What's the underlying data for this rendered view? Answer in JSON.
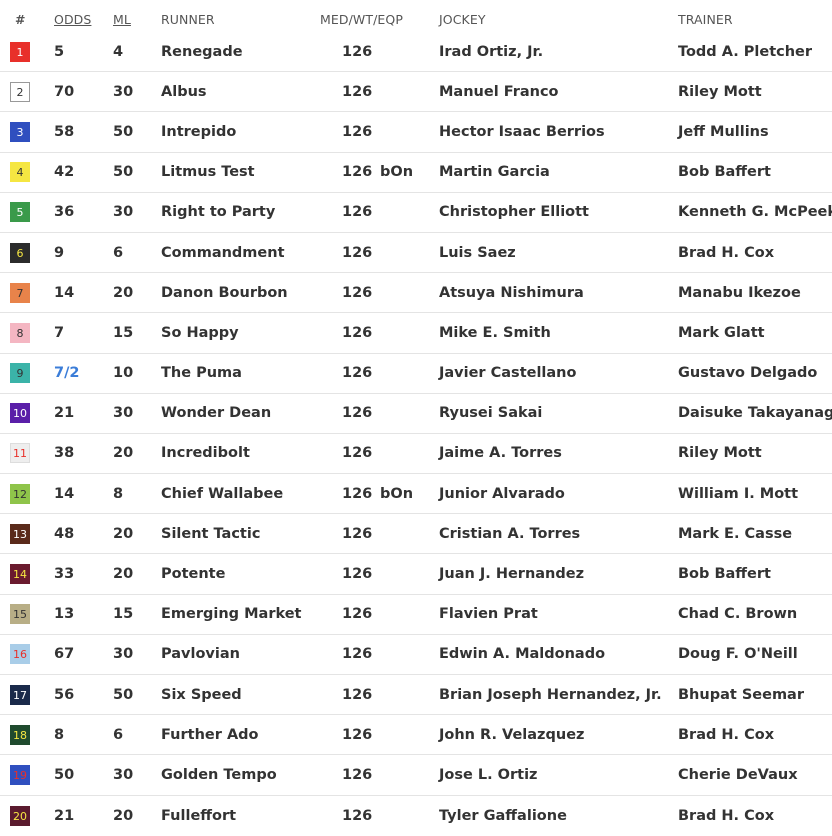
{
  "header": {
    "num": "#",
    "odds": "ODDS",
    "ml": "ML",
    "runner": "RUNNER",
    "med": "MED/WT/EQP",
    "jockey": "JOCKEY",
    "trainer": "TRAINER"
  },
  "rows": [
    {
      "pp": "1",
      "odds": "5",
      "ml": "4",
      "runner": "Renegade",
      "wt": "126",
      "eqp": "",
      "jockey": "Irad Ortiz, Jr.",
      "trainer": "Todd A. Pletcher",
      "cloth_bg": "#e8302a",
      "cloth_fg": "#ffffff",
      "cloth_border": "#e8302a"
    },
    {
      "pp": "2",
      "odds": "70",
      "ml": "30",
      "runner": "Albus",
      "wt": "126",
      "eqp": "",
      "jockey": "Manuel Franco",
      "trainer": "Riley Mott",
      "cloth_bg": "#ffffff",
      "cloth_fg": "#333333",
      "cloth_border": "#999999"
    },
    {
      "pp": "3",
      "odds": "58",
      "ml": "50",
      "runner": "Intrepido",
      "wt": "126",
      "eqp": "",
      "jockey": "Hector Isaac Berrios",
      "trainer": "Jeff Mullins",
      "cloth_bg": "#2f4fbf",
      "cloth_fg": "#ffffff",
      "cloth_border": "#2f4fbf"
    },
    {
      "pp": "4",
      "odds": "42",
      "ml": "50",
      "runner": "Litmus Test",
      "wt": "126",
      "eqp": "bOn",
      "jockey": "Martin Garcia",
      "trainer": "Bob Baffert",
      "cloth_bg": "#f5e642",
      "cloth_fg": "#333333",
      "cloth_border": "#f5e642"
    },
    {
      "pp": "5",
      "odds": "36",
      "ml": "30",
      "runner": "Right to Party",
      "wt": "126",
      "eqp": "",
      "jockey": "Christopher Elliott",
      "trainer": "Kenneth G. McPeek",
      "cloth_bg": "#3a9a4a",
      "cloth_fg": "#ffffff",
      "cloth_border": "#3a9a4a"
    },
    {
      "pp": "6",
      "odds": "9",
      "ml": "6",
      "runner": "Commandment",
      "wt": "126",
      "eqp": "",
      "jockey": "Luis Saez",
      "trainer": "Brad H. Cox",
      "cloth_bg": "#2b2b2b",
      "cloth_fg": "#f5e642",
      "cloth_border": "#2b2b2b"
    },
    {
      "pp": "7",
      "odds": "14",
      "ml": "20",
      "runner": "Danon Bourbon",
      "wt": "126",
      "eqp": "",
      "jockey": "Atsuya Nishimura",
      "trainer": "Manabu Ikezoe",
      "cloth_bg": "#e8834a",
      "cloth_fg": "#333333",
      "cloth_border": "#e8834a"
    },
    {
      "pp": "8",
      "odds": "7",
      "ml": "15",
      "runner": "So Happy",
      "wt": "126",
      "eqp": "",
      "jockey": "Mike E. Smith",
      "trainer": "Mark Glatt",
      "cloth_bg": "#f4b6c2",
      "cloth_fg": "#333333",
      "cloth_border": "#f4b6c2"
    },
    {
      "pp": "9",
      "odds": "7/2",
      "ml": "10",
      "runner": "The Puma",
      "wt": "126",
      "eqp": "",
      "jockey": "Javier Castellano",
      "trainer": "Gustavo Delgado",
      "cloth_bg": "#3bb3a8",
      "cloth_fg": "#333333",
      "cloth_border": "#3bb3a8",
      "favorite": true
    },
    {
      "pp": "10",
      "odds": "21",
      "ml": "30",
      "runner": "Wonder Dean",
      "wt": "126",
      "eqp": "",
      "jockey": "Ryusei Sakai",
      "trainer": "Daisuke Takayanagi",
      "cloth_bg": "#5a1fa8",
      "cloth_fg": "#ffffff",
      "cloth_border": "#5a1fa8"
    },
    {
      "pp": "11",
      "odds": "38",
      "ml": "20",
      "runner": "Incredibolt",
      "wt": "126",
      "eqp": "",
      "jockey": "Jaime A. Torres",
      "trainer": "Riley Mott",
      "cloth_bg": "#eeeeee",
      "cloth_fg": "#e8302a",
      "cloth_border": "#dddddd"
    },
    {
      "pp": "12",
      "odds": "14",
      "ml": "8",
      "runner": "Chief Wallabee",
      "wt": "126",
      "eqp": "bOn",
      "jockey": "Junior Alvarado",
      "trainer": "William I. Mott",
      "cloth_bg": "#8fc44a",
      "cloth_fg": "#333333",
      "cloth_border": "#8fc44a"
    },
    {
      "pp": "13",
      "odds": "48",
      "ml": "20",
      "runner": "Silent Tactic",
      "wt": "126",
      "eqp": "",
      "jockey": "Cristian A. Torres",
      "trainer": "Mark E. Casse",
      "cloth_bg": "#5a2a1a",
      "cloth_fg": "#ffffff",
      "cloth_border": "#5a2a1a"
    },
    {
      "pp": "14",
      "odds": "33",
      "ml": "20",
      "runner": "Potente",
      "wt": "126",
      "eqp": "",
      "jockey": "Juan J. Hernandez",
      "trainer": "Bob Baffert",
      "cloth_bg": "#6a1a2e",
      "cloth_fg": "#f5e642",
      "cloth_border": "#6a1a2e"
    },
    {
      "pp": "15",
      "odds": "13",
      "ml": "15",
      "runner": "Emerging Market",
      "wt": "126",
      "eqp": "",
      "jockey": "Flavien Prat",
      "trainer": "Chad C. Brown",
      "cloth_bg": "#b8ae86",
      "cloth_fg": "#333333",
      "cloth_border": "#b8ae86"
    },
    {
      "pp": "16",
      "odds": "67",
      "ml": "30",
      "runner": "Pavlovian",
      "wt": "126",
      "eqp": "",
      "jockey": "Edwin A. Maldonado",
      "trainer": "Doug F. O'Neill",
      "cloth_bg": "#a9cde8",
      "cloth_fg": "#e8302a",
      "cloth_border": "#a9cde8"
    },
    {
      "pp": "17",
      "odds": "56",
      "ml": "50",
      "runner": "Six Speed",
      "wt": "126",
      "eqp": "",
      "jockey": "Brian Joseph Hernandez, Jr.",
      "trainer": "Bhupat Seemar",
      "cloth_bg": "#1a2a4a",
      "cloth_fg": "#ffffff",
      "cloth_border": "#1a2a4a"
    },
    {
      "pp": "18",
      "odds": "8",
      "ml": "6",
      "runner": "Further Ado",
      "wt": "126",
      "eqp": "",
      "jockey": "John R. Velazquez",
      "trainer": "Brad H. Cox",
      "cloth_bg": "#1f4a2e",
      "cloth_fg": "#f5e642",
      "cloth_border": "#1f4a2e"
    },
    {
      "pp": "19",
      "odds": "50",
      "ml": "30",
      "runner": "Golden Tempo",
      "wt": "126",
      "eqp": "",
      "jockey": "Jose L. Ortiz",
      "trainer": "Cherie DeVaux",
      "cloth_bg": "#2f4fbf",
      "cloth_fg": "#e8302a",
      "cloth_border": "#2f4fbf"
    },
    {
      "pp": "20",
      "odds": "21",
      "ml": "20",
      "runner": "Fulleffort",
      "wt": "126",
      "eqp": "",
      "jockey": "Tyler Gaffalione",
      "trainer": "Brad H. Cox",
      "cloth_bg": "#5a1a2e",
      "cloth_fg": "#f5e642",
      "cloth_border": "#5a1a2e"
    }
  ]
}
